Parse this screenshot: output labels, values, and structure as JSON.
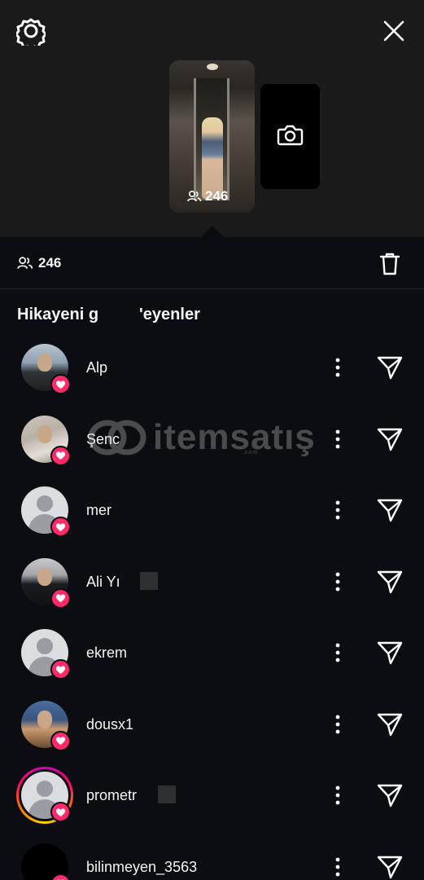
{
  "header": {
    "settings_icon": "gear-icon",
    "close_icon": "close-icon"
  },
  "story": {
    "views_count": "246",
    "views_icon": "people-icon",
    "camera_icon": "camera-icon"
  },
  "sheet": {
    "views_count": "246",
    "views_icon": "people-icon",
    "delete_icon": "trash-icon",
    "section_title": "Hikayeni g         'eyenler"
  },
  "viewers": [
    {
      "name": "Alp",
      "avatar": "photo1",
      "ring": false,
      "redact": false
    },
    {
      "name": "Şenc",
      "avatar": "photo2",
      "ring": false,
      "redact": false
    },
    {
      "name": "mer",
      "avatar": "generic",
      "ring": false,
      "redact": false
    },
    {
      "name": "Ali Yı",
      "avatar": "photo3",
      "ring": false,
      "redact": true
    },
    {
      "name": "ekrem",
      "avatar": "generic",
      "ring": false,
      "redact": false
    },
    {
      "name": "dousx1",
      "avatar": "photo4",
      "ring": false,
      "redact": false
    },
    {
      "name": "prometr",
      "avatar": "generic",
      "ring": true,
      "redact": true
    },
    {
      "name": "bilinmeyen_3563",
      "avatar": "black",
      "ring": false,
      "redact": false
    }
  ],
  "watermark": {
    "text": "itemsatış",
    "sub": ".com"
  },
  "colors": {
    "background": "#0b0d12",
    "top_area": "#1a1a1a",
    "heart_badge": "#ff2a6a"
  }
}
